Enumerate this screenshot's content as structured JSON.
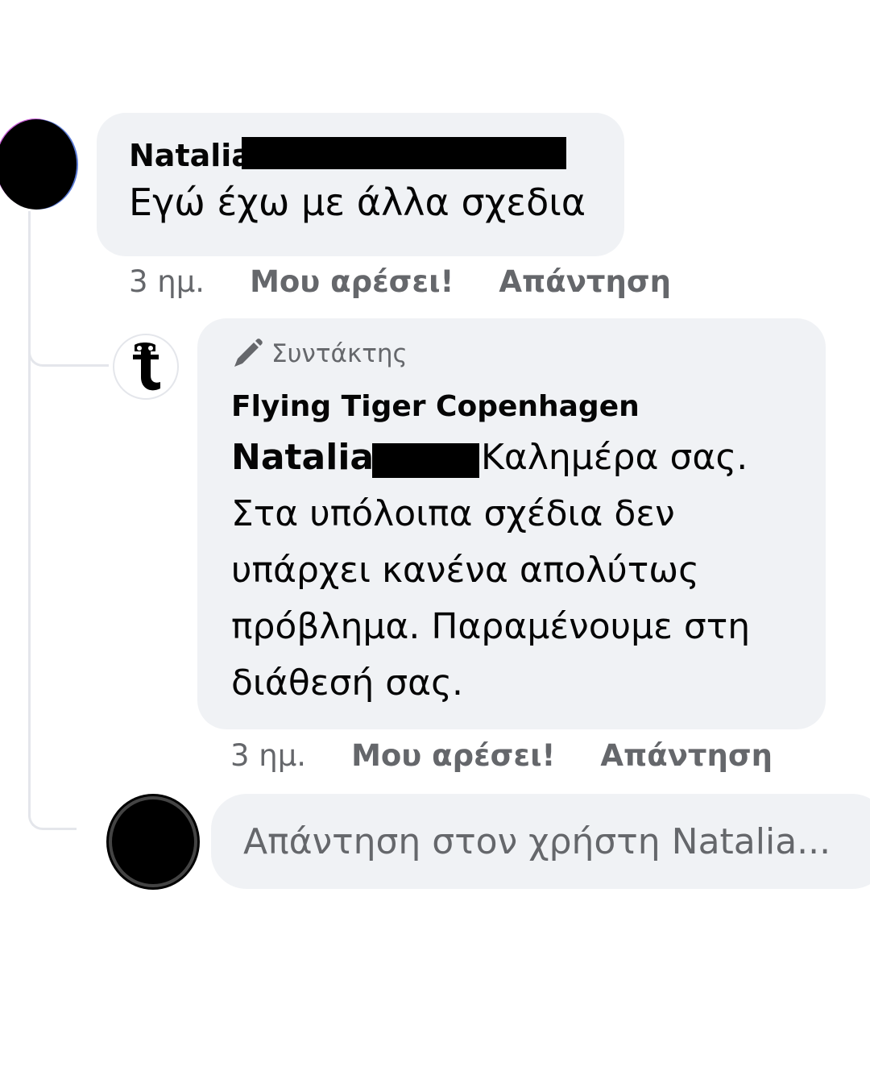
{
  "comment": {
    "author": "Natalia",
    "text": "Εγώ έχω με άλλα σχεδια",
    "time": "3 ημ.",
    "like_label": "Μου αρέσει!",
    "reply_label": "Απάντηση"
  },
  "reply": {
    "badge": "Συντάκτης",
    "author": "Flying Tiger Copenhagen",
    "mention": "Natalia",
    "text_line1": "Καλημέρα σας.",
    "text_line2": "Στα υπόλοιπα σχέδια δεν",
    "text_line3": "υπάρχει κανένα απολύτως",
    "text_line4": "πρόβλημα. Παραμένουμε στη",
    "text_line5": "διάθεσή σας.",
    "time": "3 ημ.",
    "like_label": "Μου αρέσει!",
    "reply_label": "Απάντηση"
  },
  "composer": {
    "placeholder": "Απάντηση στον χρήστη Natalia..."
  },
  "icons": {
    "badge_icon": "pencil-icon",
    "brand_logo": "flying-tiger-logo"
  }
}
